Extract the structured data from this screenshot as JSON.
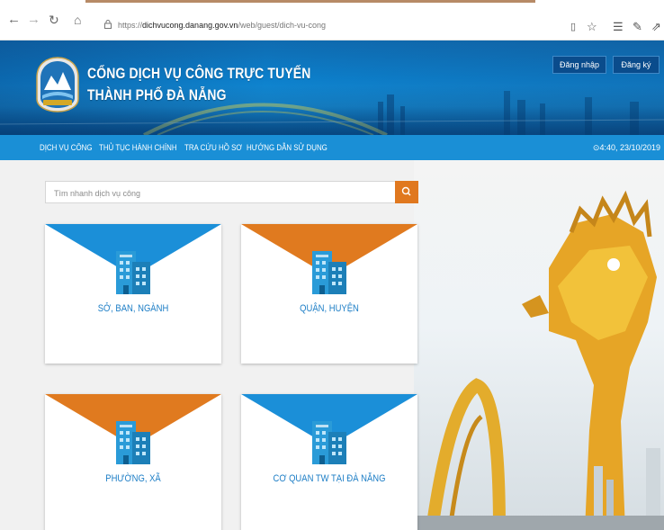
{
  "browser": {
    "url_prefix": "https://",
    "url_domain": "dichvucong.danang.gov.vn",
    "url_path": "/web/guest/dich-vu-cong"
  },
  "header": {
    "title_line1": "CỔNG DỊCH VỤ CÔNG TRỰC TUYẾN",
    "title_line2": "THÀNH PHỐ ĐÀ NẴNG",
    "logo_text": "ĐÀ NẴNG",
    "login_label": "Đăng nhập",
    "register_label": "Đăng ký"
  },
  "menu": {
    "items": [
      {
        "label": "DỊCH VỤ CÔNG"
      },
      {
        "label": "THỦ TỤC HÀNH CHÍNH"
      },
      {
        "label": "TRA CỨU HỒ SƠ"
      },
      {
        "label": "HƯỚNG DẪN SỬ DỤNG"
      }
    ],
    "datetime": "4:40, 23/10/2019"
  },
  "search": {
    "placeholder": "Tìm nhanh dịch vụ công"
  },
  "cards": [
    {
      "label": "SỞ, BAN, NGÀNH",
      "accent": "#1b8fd8"
    },
    {
      "label": "QUẬN, HUYỆN",
      "accent": "#e07a1f"
    },
    {
      "label": "PHƯỜNG, XÃ",
      "accent": "#e07a1f"
    },
    {
      "label": "CƠ QUAN TW TẠI ĐÀ NẴNG",
      "accent": "#1b8fd8"
    }
  ],
  "colors": {
    "primary": "#1a8fd6",
    "accent": "#e0781f",
    "header_dark": "#0a4c8c"
  }
}
